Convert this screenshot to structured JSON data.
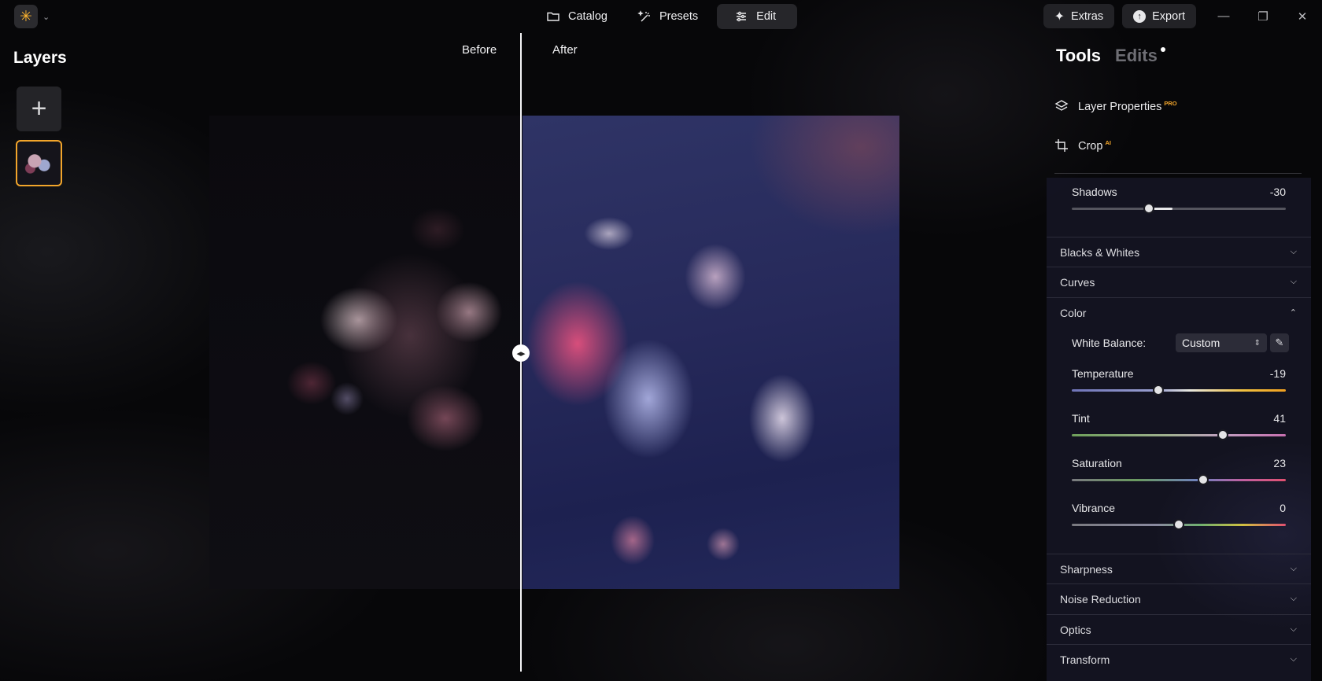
{
  "topbar": {
    "nav": [
      {
        "label": "Catalog",
        "icon": "folder-icon"
      },
      {
        "label": "Presets",
        "icon": "magic-wand-icon"
      },
      {
        "label": "Edit",
        "icon": "sliders-icon"
      }
    ],
    "extras_label": "Extras",
    "export_label": "Export"
  },
  "layers": {
    "title": "Layers"
  },
  "canvas": {
    "before_label": "Before",
    "after_label": "After"
  },
  "right_panel": {
    "tabs": {
      "tools": "Tools",
      "edits": "Edits"
    },
    "layer_properties": {
      "label": "Layer Properties",
      "badge": "PRO"
    },
    "crop": {
      "label": "Crop",
      "badge": "AI"
    },
    "shadows": {
      "label": "Shadows",
      "value": "-30",
      "position": 0.36
    },
    "sections": {
      "blacks_whites": "Blacks & Whites",
      "curves": "Curves",
      "color": "Color",
      "sharpness": "Sharpness",
      "noise_reduction": "Noise Reduction",
      "optics": "Optics",
      "transform": "Transform"
    },
    "white_balance": {
      "label": "White Balance:",
      "value": "Custom"
    },
    "temperature": {
      "label": "Temperature",
      "value": "-19",
      "position": 0.405
    },
    "tint": {
      "label": "Tint",
      "value": "41",
      "position": 0.705
    },
    "saturation": {
      "label": "Saturation",
      "value": "23",
      "position": 0.615
    },
    "vibrance": {
      "label": "Vibrance",
      "value": "0",
      "position": 0.5
    }
  },
  "colors": {
    "accent": "#f2a52b",
    "panel_bg": "#16162a"
  }
}
